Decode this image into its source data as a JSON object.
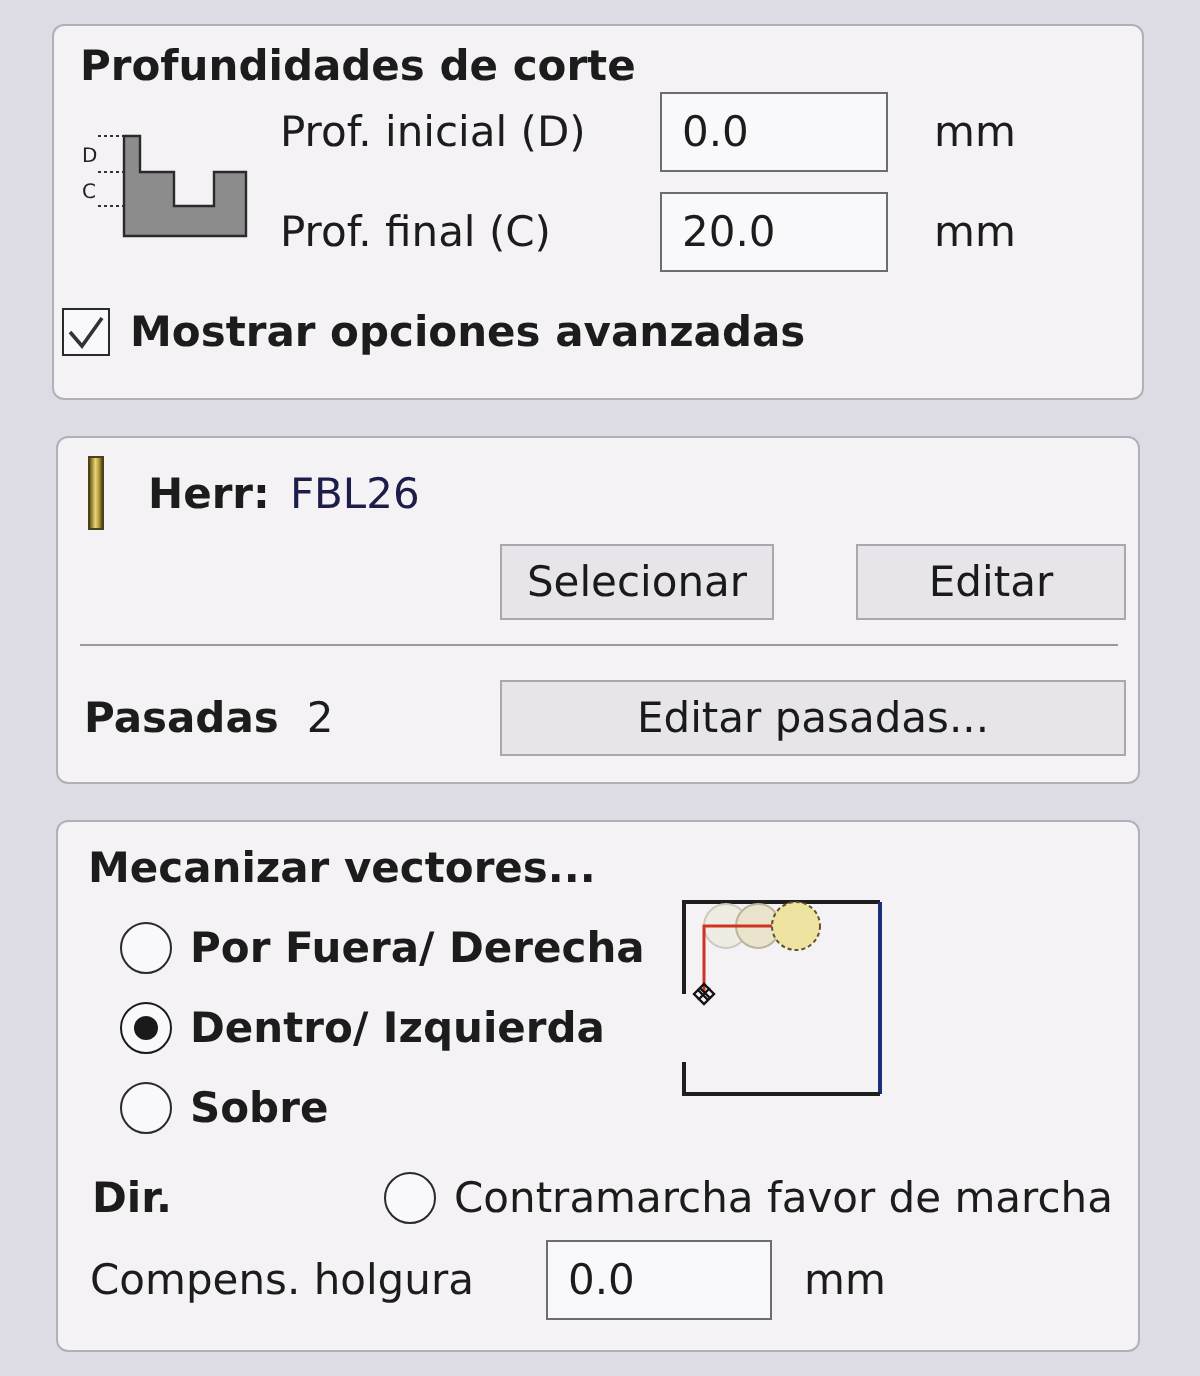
{
  "depths_panel": {
    "title": "Profundidades de corte",
    "profile_marks": [
      "D",
      "C"
    ],
    "fields": [
      {
        "label": "Prof. inicial (D)",
        "value": "0.0",
        "unit": "mm"
      },
      {
        "label": "Prof. final (C)",
        "value": "20.0",
        "unit": "mm"
      }
    ],
    "advanced_checkbox": {
      "label": "Mostrar opciones avanzadas",
      "checked": true
    }
  },
  "tool_panel": {
    "tool_label": "Herr:",
    "tool_name": "FBL26",
    "buttons": [
      "Selecionar",
      "Editar"
    ],
    "passes_label": "Pasadas",
    "passes_count": "2",
    "passes_button": "Editar pasadas..."
  },
  "machine_panel": {
    "title": "Mecanizar vectores...",
    "options": [
      {
        "label": "Por Fuera/ Derecha",
        "selected": false
      },
      {
        "label": "Dentro/ Izquierda",
        "selected": true
      },
      {
        "label": "Sobre",
        "selected": false
      }
    ],
    "direction": {
      "label": "Dir.",
      "option": {
        "label": "Contramarcha favor de marcha",
        "selected": false
      }
    },
    "allowance": {
      "label": "Compens. holgura",
      "value": "0.0",
      "unit": "mm"
    }
  }
}
